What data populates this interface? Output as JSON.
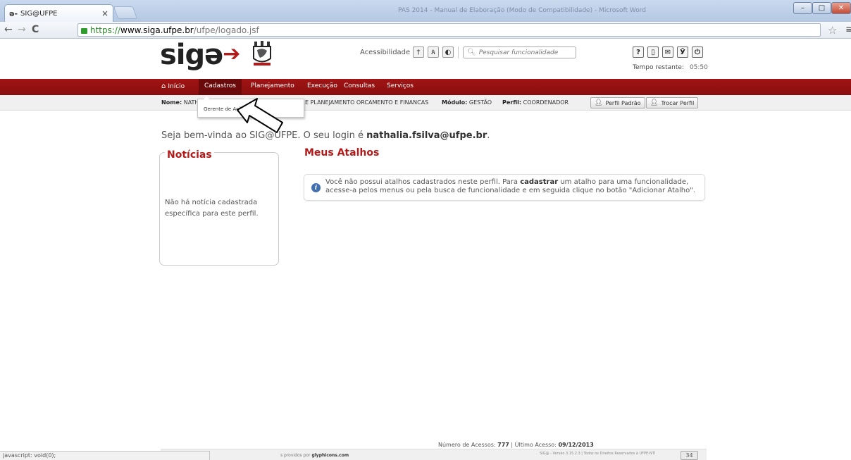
{
  "browser": {
    "tab_icon": "ə-",
    "tab_title": "SIG@UFPE",
    "tab_close": "×",
    "background_window_title": "PAS 2014 - Manual de Elaboração (Modo de Compatibilidade) - Microsoft Word",
    "url_scheme": "https://",
    "url_host": "www.siga.ufpe.br",
    "url_path": "/ufpe/logado.jsf",
    "status_text": "javascript: void(0);",
    "icons": [
      "back-icon",
      "forward-icon",
      "reload-icon",
      "lock-icon",
      "star-icon",
      "menu-icon"
    ]
  },
  "header": {
    "logo_text": "sig",
    "logo_mark": "ə",
    "logo_arrow": "➔",
    "accessibility_label": "Acessibilidade",
    "search_placeholder": "Pesquisar funcionalidade",
    "time_label": "Tempo restante:",
    "time_value": "05:50",
    "accent_color": "#b31b1b"
  },
  "menu": {
    "home": "Início",
    "items": [
      "Cadastros",
      "Planejamento",
      "Execução",
      "Consultas",
      "Serviços"
    ]
  },
  "infobar": {
    "name_label": "Nome:",
    "name_value": "NATH",
    "unit_text": "E PLANEJAMENTO ORCAMENTO E FINANCAS",
    "module_label": "Módulo:",
    "module_value": "GESTÃO",
    "profile_label": "Perfil:",
    "profile_value": "COORDENADOR",
    "default_profile_button": "Perfil Padrão",
    "change_profile_button": "Trocar Perfil"
  },
  "dropdown": {
    "item": "Gerente de Ação"
  },
  "content": {
    "welcome_prefix": "Seja bem-vinda ao SIG@UFPE. O seu login é",
    "welcome_login": "nathalia.fsilva@ufpe.br",
    "welcome_suffix": ".",
    "news_title": "Notícias",
    "news_empty": "Não há notícia cadastrada específica para este perfil.",
    "shortcuts_title": "Meus Atalhos",
    "shortcuts_msg_1": "Você não possui atalhos cadastrados neste perfil. Para",
    "shortcuts_msg_bold": "cadastrar",
    "shortcuts_msg_2": "um atalho para uma funcionalidade, acesse-a pelos menus ou pela busca de funcionalidade e em seguida clique no botão \"Adicionar Atalho\"."
  },
  "footer": {
    "access_label": "Número de Acessos:",
    "access_count": "777",
    "last_access_label": "| Último Acesso:",
    "last_access_date": "09/12/2013",
    "glyph_prefix": "s providos por",
    "glyph_link": "glyphicons.com",
    "version_text": "SIG@ - Versão 3.15.2.3 | Todos os Direitos Reservados à UFPE-NTI",
    "badge": "34"
  }
}
